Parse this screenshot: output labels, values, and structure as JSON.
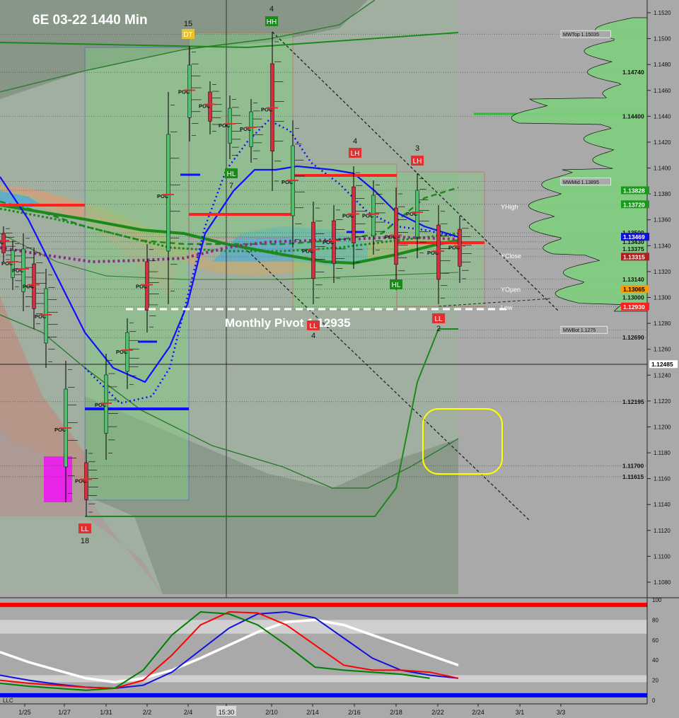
{
  "title": "6E 03-22 1440 Min",
  "colors": {
    "background": "#a9a9a9",
    "green_box": "#5fbf5f",
    "red_box": "#ff4444",
    "blue_box": "#2030ff",
    "dark_bg": "#808080"
  },
  "chart_data": [
    {
      "type": "line",
      "title": "6E 03-22 1440 Min",
      "x_ticks": [
        "1/25",
        "1/27",
        "1/31",
        "2/2",
        "2/4",
        "15:30",
        "2/10",
        "2/14",
        "2/16",
        "2/18",
        "2/22",
        "2/24",
        "3/1",
        "3/3"
      ],
      "ylim": [
        1.1065,
        1.154
      ],
      "y_ticks": [
        1.108,
        1.11,
        1.112,
        1.114,
        1.116,
        1.118,
        1.12,
        1.122,
        1.124,
        1.126,
        1.128,
        1.13,
        1.132,
        1.134,
        1.136,
        1.138,
        1.14,
        1.142,
        1.144,
        1.146,
        1.148,
        1.15,
        1.152
      ],
      "price_labels": [
        {
          "value": 1.15035,
          "text": "MWTop  1.15035",
          "style": "box"
        },
        {
          "value": 1.1474,
          "text": "1.14740",
          "style": "plain"
        },
        {
          "value": 1.144,
          "text": "1.14400",
          "style": "plain"
        },
        {
          "value": 1.13895,
          "text": "MWMid  1.13895",
          "style": "box"
        },
        {
          "value": 1.13828,
          "text": "1.13828",
          "style": "green"
        },
        {
          "value": 1.1372,
          "text": "1.13720",
          "style": "green"
        },
        {
          "value": 1.135,
          "text": "1.13500",
          "style": "plain"
        },
        {
          "value": 1.13469,
          "text": "1.13469",
          "style": "blue"
        },
        {
          "value": 1.1343,
          "text": "1.13430",
          "style": "plain"
        },
        {
          "value": 1.13375,
          "text": "1.13375",
          "style": "plain"
        },
        {
          "value": 1.13315,
          "text": "1.13315",
          "style": "darkred"
        },
        {
          "value": 1.1314,
          "text": "1.13140",
          "style": "plain"
        },
        {
          "value": 1.13065,
          "text": "1.13065",
          "style": "orange"
        },
        {
          "value": 1.13,
          "text": "1.13000",
          "style": "plain"
        },
        {
          "value": 1.1293,
          "text": "1.12930",
          "style": "red"
        },
        {
          "value": 1.1275,
          "text": "MWBot  1.1275",
          "style": "box"
        },
        {
          "value": 1.1269,
          "text": "1.12690",
          "style": "plain"
        },
        {
          "value": 1.12485,
          "text": "1.12485",
          "style": "white"
        },
        {
          "value": 1.12195,
          "text": "1.12195",
          "style": "plain"
        },
        {
          "value": 1.117,
          "text": "1.11700",
          "style": "plain"
        },
        {
          "value": 1.11615,
          "text": "1.11615",
          "style": "plain"
        }
      ],
      "level_labels": [
        {
          "value": 1.137,
          "text": "YHigh"
        },
        {
          "value": 1.1332,
          "text": "YClose"
        },
        {
          "value": 1.1306,
          "text": "YOpen"
        },
        {
          "value": 1.1292,
          "text": "Low"
        }
      ],
      "annotations": [
        {
          "text": "Monthly Pivot 1.12935",
          "value": 1.12935
        },
        {
          "text": "DT",
          "count": "15",
          "kind": "top"
        },
        {
          "text": "HH",
          "count": "4",
          "kind": "top"
        },
        {
          "text": "HL",
          "count": "7",
          "kind": "bottom"
        },
        {
          "text": "LH",
          "count": "4",
          "kind": "top"
        },
        {
          "text": "LH",
          "count": "3",
          "kind": "top"
        },
        {
          "text": "LL",
          "count": "4",
          "kind": "bottom"
        },
        {
          "text": "HL",
          "count": "",
          "kind": "bottom"
        },
        {
          "text": "LL",
          "count": "2",
          "kind": "bottom"
        },
        {
          "text": "LL",
          "count": "18",
          "kind": "bottom"
        }
      ],
      "poc_label": "POC"
    },
    {
      "type": "line",
      "ylim": [
        0,
        100
      ],
      "y_ticks": [
        0,
        20,
        40,
        60,
        80,
        100
      ],
      "left_label": "LLC",
      "series": [
        {
          "color": "#ffffff",
          "values": [
            48,
            38,
            30,
            22,
            18,
            22,
            30,
            42,
            55,
            68,
            78,
            80,
            75,
            65,
            55,
            45,
            35
          ]
        },
        {
          "color": "#1010e0",
          "values": [
            25,
            20,
            16,
            13,
            12,
            15,
            28,
            50,
            72,
            86,
            88,
            82,
            62,
            42,
            30,
            25,
            22
          ]
        },
        {
          "color": "#ff0000",
          "values": [
            20,
            17,
            15,
            13,
            12,
            20,
            45,
            75,
            88,
            87,
            75,
            55,
            35,
            30,
            30,
            28,
            22
          ]
        },
        {
          "color": "#008000",
          "values": [
            17,
            14,
            12,
            10,
            12,
            30,
            65,
            88,
            86,
            75,
            55,
            33,
            30,
            28,
            26,
            22
          ]
        }
      ]
    }
  ]
}
